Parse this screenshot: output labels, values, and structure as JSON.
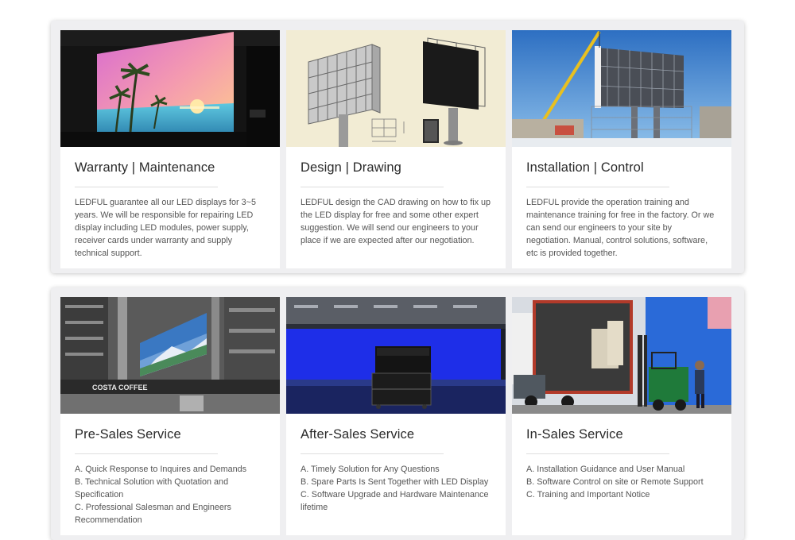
{
  "services_top": [
    {
      "title": "Warranty | Maintenance",
      "description": "LEDFUL guarantee all our LED displays for 3~5 years. We will be responsible for repairing LED display including LED modules, power supply, receiver cards under warranty and supply technical support."
    },
    {
      "title": "Design | Drawing",
      "description": "LEDFUL design the CAD drawing on how to fix up the LED display for free and some other expert suggestion. We will send our engineers to your place if we are expected after our negotiation."
    },
    {
      "title": "Installation | Control",
      "description": "LEDFUL provide the operation training and maintenance training for free in the factory. Or we can send our engineers to your site by negotiation. Manual, control solutions, software, etc is provided together."
    }
  ],
  "services_bottom": [
    {
      "title": "Pre-Sales Service",
      "sign_text": "COSTA COFFEE",
      "items": [
        "A. Quick Response to Inquires and Demands",
        "B. Technical Solution with Quotation and Specification",
        "C. Professional Salesman and Engineers Recommendation"
      ]
    },
    {
      "title": "After-Sales Service",
      "items": [
        "A. Timely Solution for Any Questions",
        "B. Spare Parts Is Sent Together with LED Display",
        "C. Software Upgrade and Hardware Maintenance lifetime"
      ]
    },
    {
      "title": "In-Sales Service",
      "items": [
        "A. Installation Guidance and User Manual",
        "B. Software Control on site or Remote Support",
        "C. Training and Important Notice"
      ]
    }
  ]
}
